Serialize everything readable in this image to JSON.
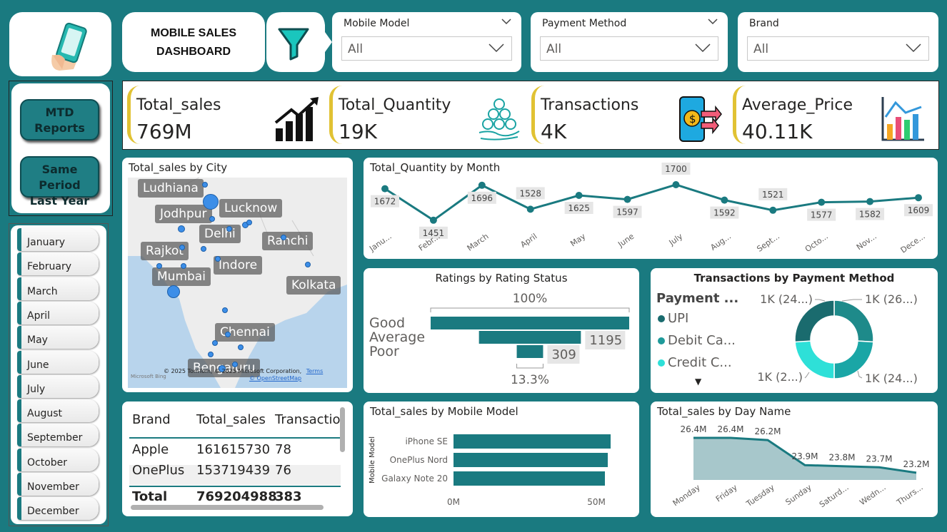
{
  "title": {
    "line1": "MOBILE SALES",
    "line2": "DASHBOARD"
  },
  "slicers": [
    {
      "title": "Mobile Model",
      "value": "All"
    },
    {
      "title": "Payment Method",
      "value": "All"
    },
    {
      "title": "Brand",
      "value": "All"
    }
  ],
  "kpis": [
    {
      "label": "Total_sales",
      "value": "769M"
    },
    {
      "label": "Total_Quantity",
      "value": "19K"
    },
    {
      "label": "Transactions",
      "value": "4K"
    },
    {
      "label": "Average_Price",
      "value": "40.11K"
    }
  ],
  "buttons": {
    "mtd_line1": "MTD",
    "mtd_line2": "Reports",
    "sply_line1": "Same Period",
    "sply_line2": "Last Year",
    "more": "···"
  },
  "months": [
    "January",
    "February",
    "March",
    "April",
    "May",
    "June",
    "July",
    "August",
    "September",
    "October",
    "November",
    "December"
  ],
  "map": {
    "title": "Total_sales by City",
    "cities": [
      "Ludhiana",
      "Jodhpur",
      "Lucknow",
      "Delhi",
      "Ranchi",
      "Rajkot",
      "Indore",
      "Mumbai",
      "Kolkata",
      "Chennai",
      "Bengaluru"
    ],
    "attribution": "© 2025 TomTom, © 2025 Microsoft Corporation,",
    "terms": "Terms",
    "osm": "© OpenStreetMap",
    "bing": "Microsoft Bing"
  },
  "qty_chart": {
    "title": "Total_Quantity by Month",
    "chart_data": {
      "type": "line",
      "categories": [
        "Janu...",
        "Febr...",
        "March",
        "April",
        "May",
        "June",
        "July",
        "Aug...",
        "Sept...",
        "Octo...",
        "Nov...",
        "Dece..."
      ],
      "values": [
        1672,
        1451,
        1696,
        1528,
        1625,
        1597,
        1700,
        1592,
        1521,
        1577,
        1582,
        1609
      ],
      "labels": [
        "1672",
        "1451",
        "1696",
        "1528",
        "1625",
        "1597",
        "1700",
        "1592",
        "1521",
        "1577",
        "1582",
        "1609"
      ]
    }
  },
  "ratings": {
    "title": "Ratings by Rating Status",
    "top_pct": "100%",
    "bottom_pct": "13.3%",
    "chart_data": {
      "type": "bar",
      "categories": [
        "Good",
        "Average",
        "Poor"
      ],
      "values": [
        2328,
        1195,
        309
      ],
      "labels": [
        "",
        "1195",
        "309"
      ]
    }
  },
  "payment": {
    "title": "Transactions by Payment Method",
    "legend_title": "Payment ...",
    "legend": [
      {
        "name": "UPI",
        "color": "#1a6b6e"
      },
      {
        "name": "Debit Ca...",
        "color": "#1e9a9a"
      },
      {
        "name": "Credit C...",
        "color": "#2ee0d8"
      }
    ],
    "chart_data": {
      "type": "pie",
      "labels": [
        "1K (26...)",
        "1K (24...)",
        "1K (2...)",
        "1K (24...)"
      ],
      "values": [
        26,
        24,
        24,
        26
      ]
    }
  },
  "matrix": {
    "headers": [
      "Brand",
      "Total_sales",
      "Transactio"
    ],
    "rows": [
      [
        "Apple",
        "161615730",
        "78"
      ],
      [
        "OnePlus",
        "153719439",
        "76"
      ]
    ],
    "total": [
      "Total",
      "769204988",
      "383"
    ]
  },
  "model_chart": {
    "title": "Total_sales by Mobile Model",
    "y_axis_title": "Mobile Model",
    "chart_data": {
      "type": "bar",
      "categories": [
        "iPhone SE",
        "OnePlus Nord",
        "Galaxy Note 20"
      ],
      "values": [
        55,
        54,
        53
      ],
      "xticks": [
        "0M",
        "50M"
      ],
      "xlim": [
        0,
        60
      ]
    }
  },
  "day_chart": {
    "title": "Total_sales by Day Name",
    "chart_data": {
      "type": "area",
      "categories": [
        "Monday",
        "Friday",
        "Tuesday",
        "Sunday",
        "Saturd...",
        "Wedn...",
        "Thurs..."
      ],
      "values": [
        26.4,
        26.4,
        26.2,
        23.9,
        23.8,
        23.7,
        23.2
      ],
      "labels": [
        "26.4M",
        "26.4M",
        "26.2M",
        "23.9M",
        "23.8M",
        "23.7M",
        "23.2M"
      ]
    }
  }
}
